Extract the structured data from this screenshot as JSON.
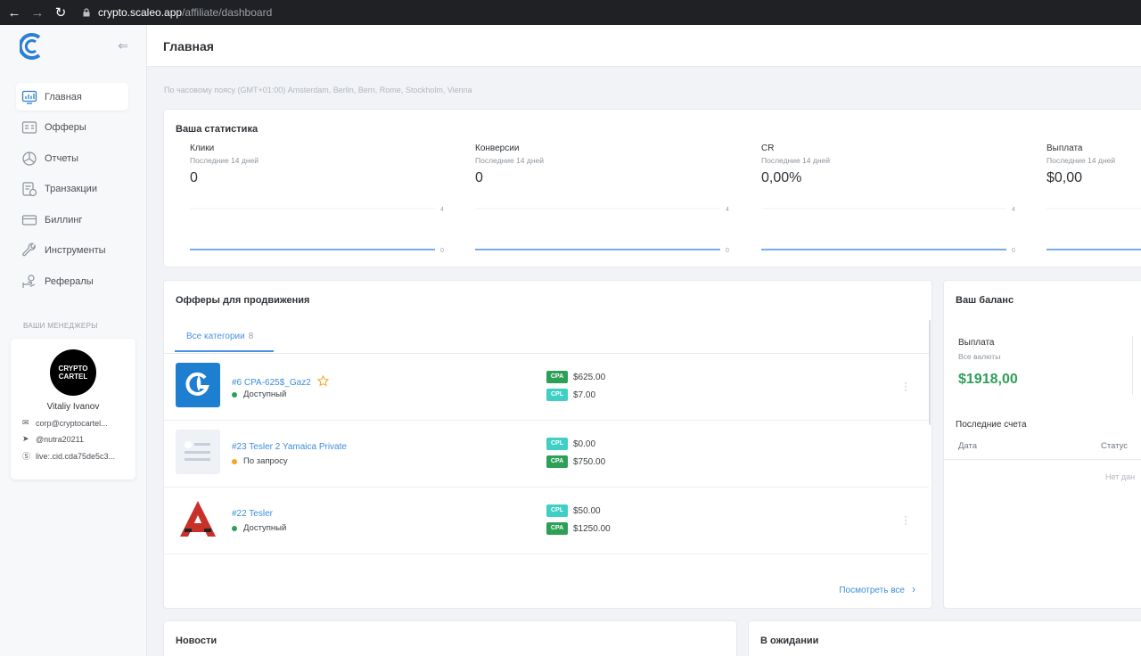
{
  "browser": {
    "url_domain": "crypto.scaleo.app",
    "url_path": "/affiliate/dashboard"
  },
  "header": {
    "title": "Главная"
  },
  "timezone": "По часовому поясу (GMT+01:00) Amsterdam, Berlin, Bern, Rome, Stockholm, Vienna",
  "sidebar": {
    "items": [
      {
        "label": "Главная",
        "icon": "chart-icon"
      },
      {
        "label": "Офферы",
        "icon": "offers-icon"
      },
      {
        "label": "Отчеты",
        "icon": "reports-icon"
      },
      {
        "label": "Транзакции",
        "icon": "transactions-icon"
      },
      {
        "label": "Биллинг",
        "icon": "billing-icon"
      },
      {
        "label": "Инструменты",
        "icon": "wrench-icon"
      },
      {
        "label": "Рефералы",
        "icon": "referrals-icon"
      }
    ],
    "managers_title": "ВАШИ МЕНЕДЖЕРЫ",
    "manager": {
      "avatar_text": "CRYPTO CARTEL",
      "name": "Vitaliy Ivanov",
      "email": "corp@cryptocartel...",
      "telegram": "@nutra20211",
      "skype": "live:.cid.cda75de5c3..."
    }
  },
  "stats": {
    "title": "Ваша статистика",
    "items": [
      {
        "label": "Клики",
        "sub": "Последние 14 дней",
        "value": "0",
        "max": "4",
        "min": "0"
      },
      {
        "label": "Конверсии",
        "sub": "Последние 14 дней",
        "value": "0",
        "max": "4",
        "min": "0"
      },
      {
        "label": "CR",
        "sub": "Последние 14 дней",
        "value": "0,00%",
        "max": "4",
        "min": "0"
      },
      {
        "label": "Выплата",
        "sub": "Последние 14 дней",
        "value": "$0,00"
      }
    ]
  },
  "offers": {
    "title": "Офферы для продвижения",
    "tab_label": "Все категории",
    "tab_count": "8",
    "items": [
      {
        "name": "#6  CPA-625$_Gaz2",
        "status": "Доступный",
        "status_color": "#2d9f57",
        "pay1_type": "CPA",
        "pay1": "$625.00",
        "pay2_type": "CPL",
        "pay2": "$7.00"
      },
      {
        "name": "#23  Tesler 2 Yamaica Private",
        "status": "По запросу",
        "status_color": "#f5a623",
        "pay1_type": "CPL",
        "pay1": "$0.00",
        "pay2_type": "CPA",
        "pay2": "$750.00"
      },
      {
        "name": "#22  Tesler",
        "status": "Доступный",
        "status_color": "#2d9f57",
        "pay1_type": "CPL",
        "pay1": "$50.00",
        "pay2_type": "CPA",
        "pay2": "$1250.00"
      }
    ],
    "see_all": "Посмотреть все"
  },
  "balance": {
    "title": "Ваш баланс",
    "label": "Выплата",
    "sub": "Все валюты",
    "value": "$1918,00",
    "invoices_title": "Последние счета",
    "col_date": "Дата",
    "col_status": "Статус",
    "no_data": "Нет дан"
  },
  "news": {
    "title": "Новости"
  },
  "pending": {
    "title": "В ожидании"
  },
  "colors": {
    "accent": "#4a90e2",
    "cpa": "#2d9f57",
    "cpl": "#3fcfc4"
  }
}
